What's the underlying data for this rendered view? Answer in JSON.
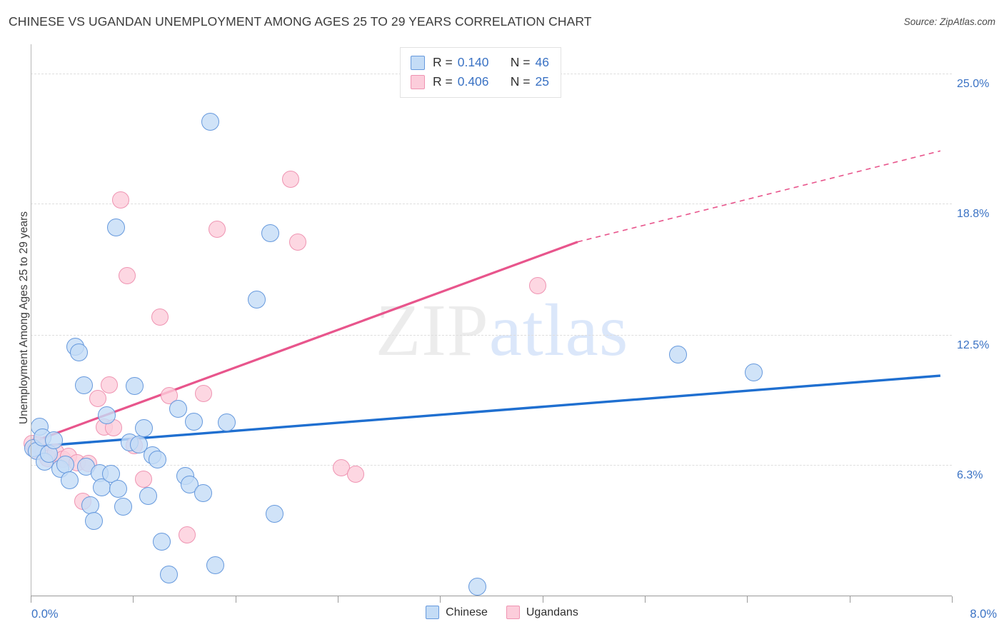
{
  "header": {
    "title": "CHINESE VS UGANDAN UNEMPLOYMENT AMONG AGES 25 TO 29 YEARS CORRELATION CHART",
    "source": "Source: ZipAtlas.com"
  },
  "watermark": {
    "part1": "ZIP",
    "part2": "atlas"
  },
  "stats": {
    "rows": [
      {
        "r_label": "R =",
        "r_value": "0.140",
        "n_label": "N =",
        "n_value": "46",
        "color": "#c4dcf6"
      },
      {
        "r_label": "R =",
        "r_value": "0.406",
        "n_label": "N =",
        "n_value": "25",
        "color": "#fccddb"
      }
    ]
  },
  "legend": {
    "entries": [
      {
        "label": "Chinese",
        "color": "#c4dcf6",
        "border": "#6699dd"
      },
      {
        "label": "Ugandans",
        "color": "#fccddb",
        "border": "#ef94b2"
      }
    ]
  },
  "chart_data": {
    "type": "scatter",
    "title": "CHINESE VS UGANDAN UNEMPLOYMENT AMONG AGES 25 TO 29 YEARS CORRELATION CHART",
    "xlabel": "",
    "ylabel": "Unemployment Among Ages 25 to 29 years",
    "xlim": [
      0.0,
      8.0
    ],
    "ylim": [
      0.0,
      26.4
    ],
    "x_tick_labels": [
      "0.0%",
      "8.0%"
    ],
    "y_tick_labels": [
      "6.3%",
      "12.5%",
      "18.8%",
      "25.0%"
    ],
    "y_tick_values": [
      6.3,
      12.5,
      18.8,
      25.0
    ],
    "grid": "horizontal-dashed",
    "legend_position": "bottom-center",
    "colors": {
      "chinese_fill": "#c4dcf6",
      "chinese_stroke": "#6699dd",
      "ugandan_fill": "#fccddb",
      "ugandan_stroke": "#ef94b2",
      "chinese_trend": "#1f6fd0",
      "ugandan_trend": "#e8558c",
      "tick_label": "#3a72c4"
    },
    "series": [
      {
        "name": "Chinese",
        "r": 0.14,
        "n": 46,
        "trendline": {
          "x0": 0.0,
          "y0": 7.15,
          "x1": 7.9,
          "y1": 10.55,
          "style": "solid"
        },
        "points": [
          [
            0.02,
            7.1
          ],
          [
            0.05,
            6.95
          ],
          [
            0.08,
            8.1
          ],
          [
            0.1,
            7.6
          ],
          [
            0.12,
            6.45
          ],
          [
            0.16,
            6.8
          ],
          [
            0.2,
            7.45
          ],
          [
            0.26,
            6.1
          ],
          [
            0.3,
            6.3
          ],
          [
            0.34,
            5.55
          ],
          [
            0.39,
            11.95
          ],
          [
            0.42,
            11.65
          ],
          [
            0.46,
            10.1
          ],
          [
            0.48,
            6.2
          ],
          [
            0.52,
            4.35
          ],
          [
            0.55,
            3.6
          ],
          [
            0.6,
            5.9
          ],
          [
            0.62,
            5.2
          ],
          [
            0.66,
            8.65
          ],
          [
            0.7,
            5.85
          ],
          [
            0.74,
            17.65
          ],
          [
            0.76,
            5.15
          ],
          [
            0.8,
            4.3
          ],
          [
            0.86,
            7.35
          ],
          [
            0.9,
            10.05
          ],
          [
            0.94,
            7.25
          ],
          [
            0.98,
            8.05
          ],
          [
            1.02,
            4.8
          ],
          [
            1.06,
            6.75
          ],
          [
            1.1,
            6.55
          ],
          [
            1.14,
            2.6
          ],
          [
            1.2,
            1.05
          ],
          [
            1.28,
            8.95
          ],
          [
            1.34,
            5.75
          ],
          [
            1.38,
            5.35
          ],
          [
            1.42,
            8.35
          ],
          [
            1.5,
            4.95
          ],
          [
            1.56,
            22.7
          ],
          [
            1.6,
            1.5
          ],
          [
            1.7,
            8.3
          ],
          [
            1.96,
            14.2
          ],
          [
            2.08,
            17.35
          ],
          [
            2.12,
            3.95
          ],
          [
            3.88,
            0.45
          ],
          [
            5.62,
            11.55
          ],
          [
            6.28,
            10.7
          ]
        ]
      },
      {
        "name": "Ugandans",
        "r": 0.406,
        "n": 25,
        "trendline_solid": {
          "x0": 0.0,
          "y0": 7.35,
          "x1": 4.75,
          "y1": 16.95
        },
        "trendline_dashed": {
          "x0": 4.75,
          "y0": 16.95,
          "x1": 7.9,
          "y1": 21.3
        },
        "points": [
          [
            0.01,
            7.3
          ],
          [
            0.04,
            7.0
          ],
          [
            0.07,
            7.25
          ],
          [
            0.11,
            6.85
          ],
          [
            0.15,
            6.6
          ],
          [
            0.22,
            6.9
          ],
          [
            0.28,
            6.55
          ],
          [
            0.33,
            6.7
          ],
          [
            0.4,
            6.4
          ],
          [
            0.45,
            4.55
          ],
          [
            0.5,
            6.35
          ],
          [
            0.58,
            9.45
          ],
          [
            0.64,
            8.1
          ],
          [
            0.68,
            10.1
          ],
          [
            0.72,
            8.05
          ],
          [
            0.78,
            18.95
          ],
          [
            0.84,
            15.35
          ],
          [
            0.9,
            7.2
          ],
          [
            0.98,
            5.6
          ],
          [
            1.12,
            13.35
          ],
          [
            1.2,
            9.6
          ],
          [
            1.36,
            2.95
          ],
          [
            1.5,
            9.7
          ],
          [
            1.62,
            17.55
          ],
          [
            2.26,
            19.95
          ],
          [
            2.32,
            16.95
          ],
          [
            2.7,
            6.15
          ],
          [
            2.82,
            5.85
          ],
          [
            4.4,
            14.85
          ]
        ]
      }
    ]
  }
}
